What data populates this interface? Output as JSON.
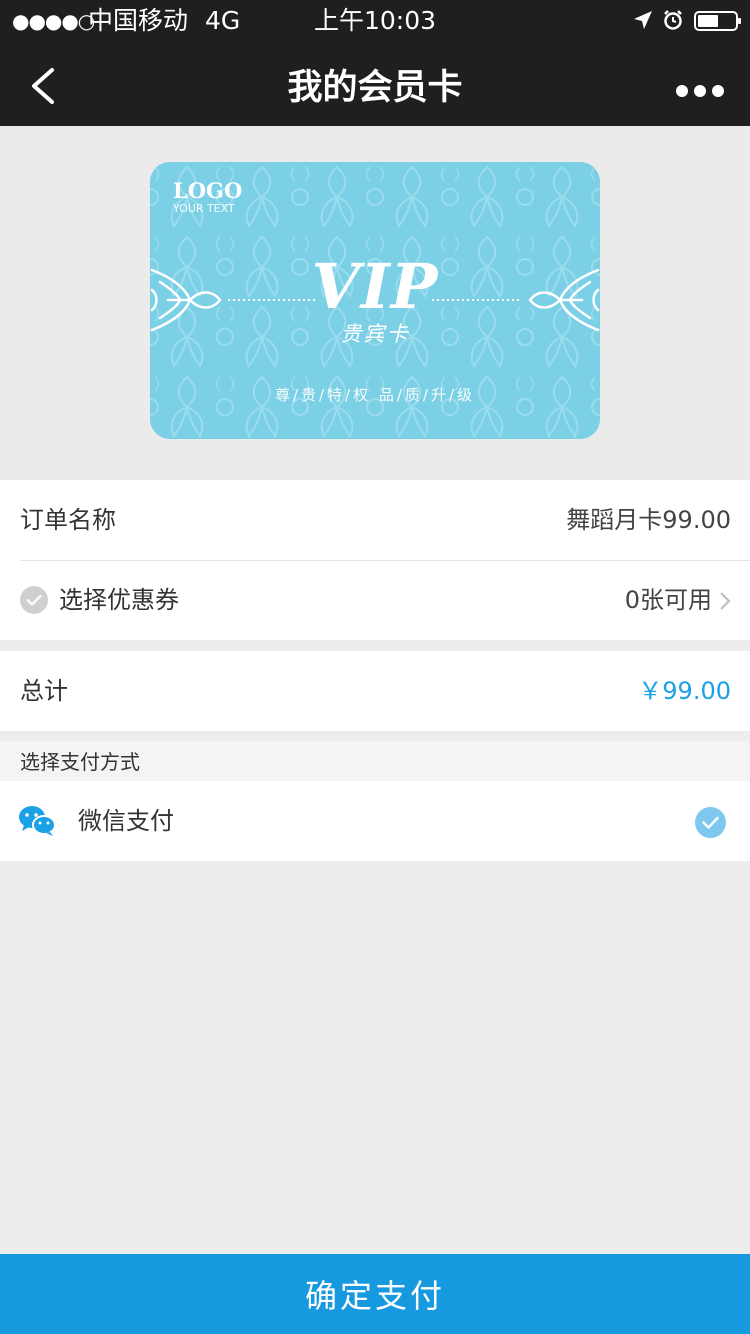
{
  "status_bar": {
    "signal": "●●●●○",
    "carrier": "中国移动",
    "network": "4G",
    "time": "上午10:03"
  },
  "nav": {
    "title": "我的会员卡"
  },
  "card": {
    "logo": "LOGO",
    "logo_sub": "YOUR TEXT",
    "vip": "VIP",
    "vip_sub": "贵宾卡",
    "slogan": "尊/贵/特/权  品/质/升/级",
    "colors": {
      "background": "#7cd0e6",
      "pattern": "#9adcee"
    }
  },
  "order": {
    "name_label": "订单名称",
    "name_value": "舞蹈月卡99.00",
    "coupon_label": "选择优惠券",
    "coupon_value": "0张可用"
  },
  "total": {
    "label": "总计",
    "value": "￥99.00"
  },
  "payment": {
    "header": "选择支付方式",
    "method": "微信支付",
    "selected": true
  },
  "confirm_label": "确定支付",
  "colors": {
    "accent": "#1799e0",
    "price": "#1aa1e6",
    "check": "#7ec8ef",
    "wechat": "#1aa1e6",
    "header_bg": "#1f1f22"
  }
}
